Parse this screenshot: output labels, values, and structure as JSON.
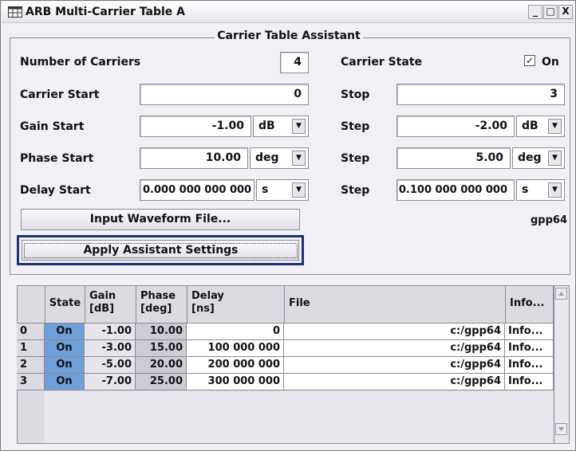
{
  "window": {
    "title": "ARB Multi-Carrier Table A",
    "controls": {
      "minimize": "_",
      "maximize": "□",
      "close": "X"
    }
  },
  "assistant": {
    "group_title": "Carrier Table Assistant",
    "num_carriers_label": "Number of Carriers",
    "num_carriers_value": "4",
    "carrier_state_label": "Carrier State",
    "carrier_state_checkbox": "✓",
    "carrier_state_value": "On",
    "carrier_start_label": "Carrier Start",
    "carrier_start_value": "0",
    "carrier_stop_label": "Stop",
    "carrier_stop_value": "3",
    "gain_start_label": "Gain Start",
    "gain_start_value": "-1.00",
    "gain_start_unit": "dB",
    "gain_step_label": "Step",
    "gain_step_value": "-2.00",
    "gain_step_unit": "dB",
    "phase_start_label": "Phase Start",
    "phase_start_value": "10.00",
    "phase_start_unit": "deg",
    "phase_step_label": "Step",
    "phase_step_value": "5.00",
    "phase_step_unit": "deg",
    "delay_start_label": "Delay Start",
    "delay_start_value": "0.000 000 000 000",
    "delay_start_unit": "s",
    "delay_step_label": "Step",
    "delay_step_value": "0.100 000 000 000",
    "delay_step_unit": "s",
    "input_waveform_button": "Input Waveform File...",
    "waveform_name": "gpp64",
    "apply_button": "Apply Assistant Settings",
    "dropdown_arrow": "▼"
  },
  "table": {
    "headers": {
      "state": "State",
      "gain_1": "Gain",
      "gain_2": "[dB]",
      "phase_1": "Phase",
      "phase_2": "[deg]",
      "delay_1": "Delay",
      "delay_2": "[ns]",
      "file": "File",
      "info": "Info..."
    },
    "rows": [
      {
        "index": "0",
        "state": "On",
        "gain": "-1.00",
        "phase": "10.00",
        "delay": "0",
        "file": "c:/gpp64",
        "info": "Info..."
      },
      {
        "index": "1",
        "state": "On",
        "gain": "-3.00",
        "phase": "15.00",
        "delay": "100 000 000",
        "file": "c:/gpp64",
        "info": "Info..."
      },
      {
        "index": "2",
        "state": "On",
        "gain": "-5.00",
        "phase": "20.00",
        "delay": "200 000 000",
        "file": "c:/gpp64",
        "info": "Info..."
      },
      {
        "index": "3",
        "state": "On",
        "gain": "-7.00",
        "phase": "25.00",
        "delay": "300 000 000",
        "file": "c:/gpp64",
        "info": "Info..."
      }
    ]
  },
  "colors": {
    "state_cell": "#6e9fd8",
    "apply_frame": "#1c2f7a"
  }
}
